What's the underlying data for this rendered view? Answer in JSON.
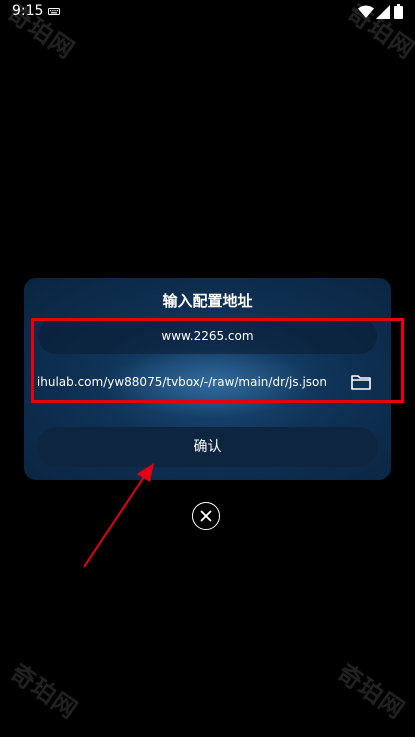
{
  "status_bar": {
    "time": "9:15"
  },
  "watermark": {
    "text": "奇珀网"
  },
  "dialog": {
    "title": "输入配置地址",
    "primary_address": "www.2265.com",
    "config_url": "ihulab.com/yw88075/tvbox/-/raw/main/dr/js.json",
    "confirm_label": "确认"
  },
  "colors": {
    "background": "#000000",
    "dialog_bg": "#0f3256",
    "annotation_red": "#e60012"
  },
  "icons": [
    "keyboard-icon",
    "wifi-icon",
    "signal-icon",
    "battery-icon",
    "folder-icon",
    "close-icon"
  ]
}
